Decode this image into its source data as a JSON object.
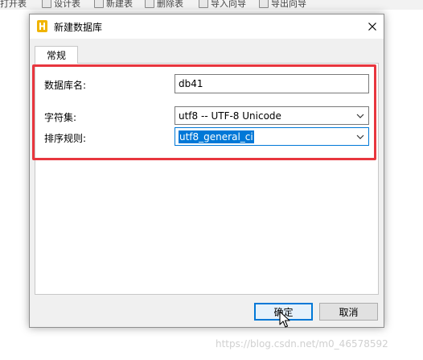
{
  "toolbar": {
    "items": [
      "打开表",
      "设计表",
      "新建表",
      "删除表",
      "导入向导",
      "导出向导"
    ]
  },
  "dialog": {
    "title": "新建数据库",
    "tabs": [
      {
        "label": "常规",
        "active": true
      }
    ],
    "fields": {
      "db_name": {
        "label": "数据库名:",
        "value": "db41"
      },
      "charset": {
        "label": "字符集:",
        "value": "utf8 -- UTF-8 Unicode"
      },
      "collation": {
        "label": "排序规则:",
        "value": "utf8_general_ci"
      }
    },
    "buttons": {
      "ok": "确定",
      "cancel": "取消"
    }
  },
  "watermark": "https://blog.csdn.net/m0_46578592",
  "colors": {
    "highlight": "#e8363e",
    "accent": "#0078d7",
    "app_icon": "#f0b400"
  },
  "icons": [
    "table-icon",
    "database-app-icon",
    "close-icon",
    "chevron-down-icon",
    "mouse-cursor-icon"
  ]
}
